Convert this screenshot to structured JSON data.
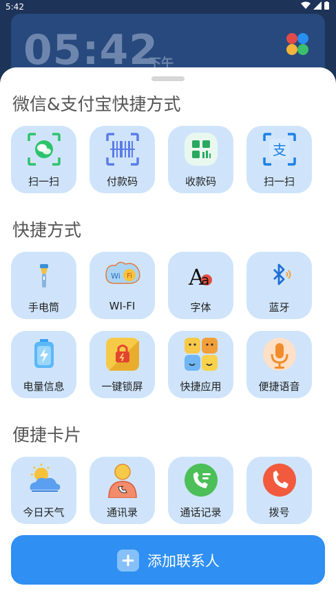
{
  "status_bar": {
    "time": "5:42"
  },
  "widget": {
    "clock": "05:42",
    "ampm": "下午"
  },
  "sections": [
    {
      "title": "微信&支付宝快捷方式",
      "items": [
        {
          "label": "扫一扫",
          "icon": "wechat-scan-icon"
        },
        {
          "label": "付款码",
          "icon": "barcode-icon"
        },
        {
          "label": "收款码",
          "icon": "qr-collect-icon"
        },
        {
          "label": "扫一扫",
          "icon": "alipay-scan-icon"
        }
      ]
    },
    {
      "title": "快捷方式",
      "items": [
        {
          "label": "手电筒",
          "icon": "flashlight-icon"
        },
        {
          "label": "WI-FI",
          "icon": "wifi-icon"
        },
        {
          "label": "字体",
          "icon": "font-icon"
        },
        {
          "label": "蓝牙",
          "icon": "bluetooth-icon"
        },
        {
          "label": "电量信息",
          "icon": "battery-icon"
        },
        {
          "label": "一键锁屏",
          "icon": "lock-icon"
        },
        {
          "label": "快捷应用",
          "icon": "apps-grid-icon"
        },
        {
          "label": "便捷语音",
          "icon": "microphone-icon"
        }
      ]
    },
    {
      "title": "便捷卡片",
      "items": [
        {
          "label": "今日天气",
          "icon": "weather-icon"
        },
        {
          "label": "通讯录",
          "icon": "contacts-icon"
        },
        {
          "label": "通话记录",
          "icon": "call-log-icon"
        },
        {
          "label": "拨号",
          "icon": "dialer-icon"
        }
      ]
    }
  ],
  "add_contact": {
    "label": "添加联系人"
  },
  "colors": {
    "tile": "#cfe4fb",
    "accent": "#2f8ff2"
  }
}
